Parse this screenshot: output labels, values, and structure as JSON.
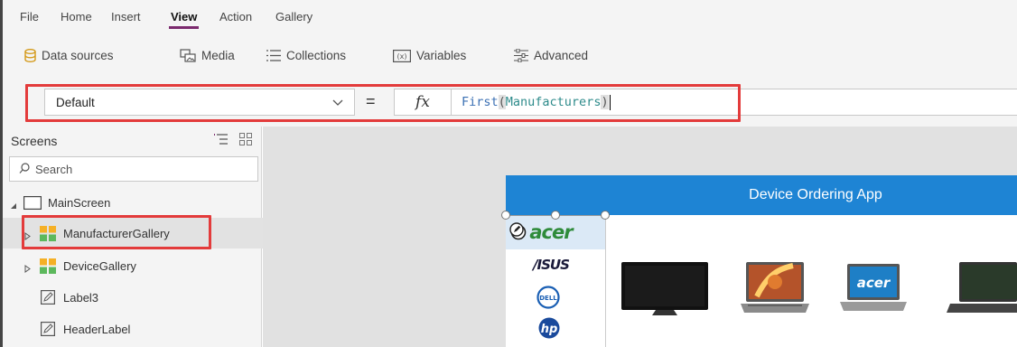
{
  "menu": {
    "tabs": [
      "File",
      "Home",
      "Insert",
      "View",
      "Action",
      "Gallery"
    ],
    "active_tab": "View"
  },
  "ribbon": {
    "items": [
      {
        "label": "Data sources",
        "icon": "database-icon"
      },
      {
        "label": "Media",
        "icon": "media-icon"
      },
      {
        "label": "Collections",
        "icon": "collections-icon"
      },
      {
        "label": "Variables",
        "icon": "variables-icon"
      },
      {
        "label": "Advanced",
        "icon": "advanced-icon"
      }
    ]
  },
  "formula_bar": {
    "property": "Default",
    "equals": "=",
    "fx": "fx",
    "formula_fn": "First",
    "formula_open": "(",
    "formula_arg": "Manufacturers",
    "formula_close": ")"
  },
  "tree": {
    "header": "Screens",
    "search_placeholder": "Search",
    "items": [
      {
        "label": "MainScreen",
        "icon": "screen-icon",
        "selected": false
      },
      {
        "label": "ManufacturerGallery",
        "icon": "gallery-icon",
        "selected": true
      },
      {
        "label": "DeviceGallery",
        "icon": "gallery-icon",
        "selected": false
      },
      {
        "label": "Label3",
        "icon": "label-icon",
        "selected": false
      },
      {
        "label": "HeaderLabel",
        "icon": "label-icon",
        "selected": false
      }
    ]
  },
  "app": {
    "title": "Device Ordering App",
    "manufacturers": [
      "acer",
      "ASUS",
      "DELL",
      "hp"
    ],
    "devices": [
      "monitor",
      "gaming-laptop",
      "acer-laptop",
      "laptop"
    ]
  },
  "colors": {
    "accent": "#7b2a6e",
    "highlight": "#e33b3b",
    "app_header": "#1e84d4",
    "selected_row": "#dbe9f6"
  }
}
